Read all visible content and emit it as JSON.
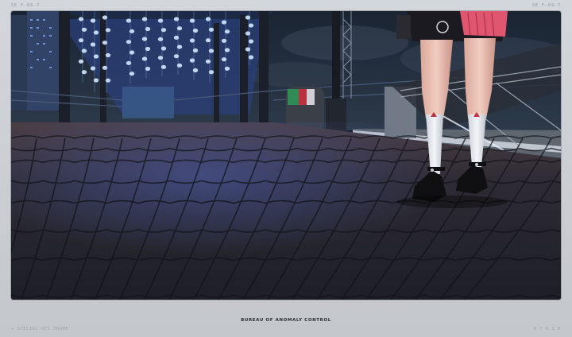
{
  "frame": {
    "top_left": "SE  F-09-7",
    "top_right": "SE  F-09-7",
    "caption": "BUREAU OF ANOMALY CONTROL",
    "footer_left": "+ SPECIAL RES FRAME",
    "footer_right": "R T 0 1 0"
  },
  "scene": {
    "description_icon": "night-boardwalk-scene",
    "colors": {
      "sky": "#1e2b3c",
      "lanterns": "#9fd0ff",
      "pavement": "#2a2830",
      "skirt": "#e0566f",
      "frame": "#c9ccd1"
    }
  }
}
